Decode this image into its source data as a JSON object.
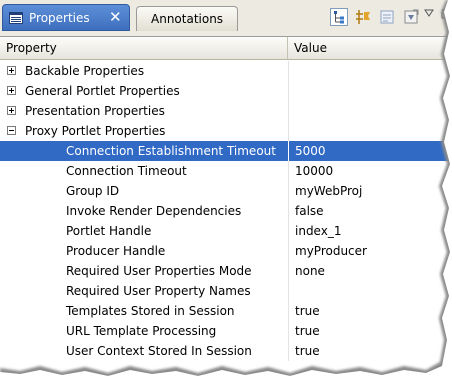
{
  "tabs": {
    "active": {
      "label": "Properties"
    },
    "inactive": {
      "label": "Annotations"
    }
  },
  "toolbar": {
    "buttons": [
      {
        "name": "show-categories-icon",
        "pressed": true
      },
      {
        "name": "show-advanced-icon",
        "pressed": false
      },
      {
        "name": "restore-default-icon",
        "pressed": false
      },
      {
        "name": "filter-icon",
        "pressed": false
      }
    ],
    "menu_icon": "view-menu-icon"
  },
  "table": {
    "headers": [
      "Property",
      "Value"
    ],
    "categories": [
      {
        "label": "Backable Properties",
        "expanded": false
      },
      {
        "label": "General Portlet Properties",
        "expanded": false
      },
      {
        "label": "Presentation Properties",
        "expanded": false
      },
      {
        "label": "Proxy Portlet Properties",
        "expanded": true
      }
    ],
    "properties": [
      {
        "name": "Connection Establishment Timeout",
        "value": "5000",
        "selected": true
      },
      {
        "name": "Connection Timeout",
        "value": "10000"
      },
      {
        "name": "Group ID",
        "value": "myWebProj"
      },
      {
        "name": "Invoke Render Dependencies",
        "value": "false"
      },
      {
        "name": "Portlet Handle",
        "value": "index_1"
      },
      {
        "name": "Producer Handle",
        "value": "myProducer"
      },
      {
        "name": "Required User Properties Mode",
        "value": "none"
      },
      {
        "name": "Required User Property Names",
        "value": ""
      },
      {
        "name": "Templates Stored in Session",
        "value": "true"
      },
      {
        "name": "URL Template Processing",
        "value": "true"
      },
      {
        "name": "User Context Stored In Session",
        "value": "true"
      }
    ]
  },
  "colors": {
    "selection": "#316ac5",
    "tab_active": "#4a7ccc",
    "chrome": "#eceae1"
  }
}
